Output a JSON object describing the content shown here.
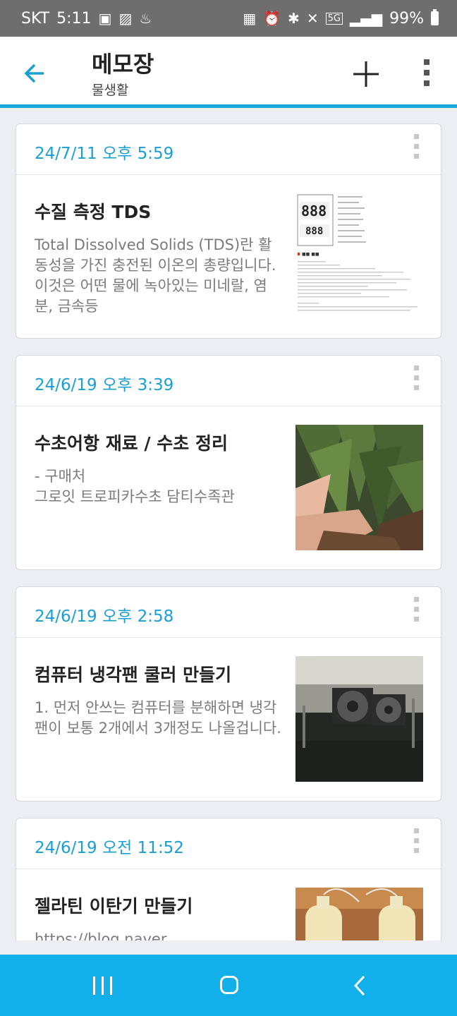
{
  "status_bar": {
    "carrier": "SKT",
    "time": "5:11",
    "network": "5G",
    "battery": "99%"
  },
  "app_bar": {
    "title": "메모장",
    "subtitle": "물생활"
  },
  "notes": [
    {
      "date": "24/7/11 오후 5:59",
      "title": "수질 측정 TDS",
      "preview": "Total Dissolved Solids (TDS)란 활동성을 가진 충전된 이온의 총량입니다. 이것은 어떤 물에 녹아있는 미네랄, 염분, 금속등",
      "thumbnail": "tds-document-image"
    },
    {
      "date": "24/6/19 오후 3:39",
      "title": "수초어항 재료 / 수초 정리",
      "preview": "- 구매처\n그로잇 트로피카수초 담티수족관",
      "thumbnail": "aquatic-plant-photo"
    },
    {
      "date": "24/6/19 오후 2:58",
      "title": "컴퓨터 냉각팬 쿨러 만들기",
      "preview": "1. 먼저 안쓰는 컴퓨터를 분해하면 냉각팬이 보통 2개에서 3개정도 나올겁니다.",
      "thumbnail": "cooling-fan-photo"
    },
    {
      "date": "24/6/19 오전 11:52",
      "title": "젤라틴 이탄기 만들기",
      "preview": "https://blog.naver",
      "thumbnail": "bottles-photo"
    }
  ],
  "colors": {
    "accent": "#1aa6d8",
    "nav_bar": "#12b0ea",
    "status_bar": "#6e6e6e",
    "background": "#eceef3"
  }
}
